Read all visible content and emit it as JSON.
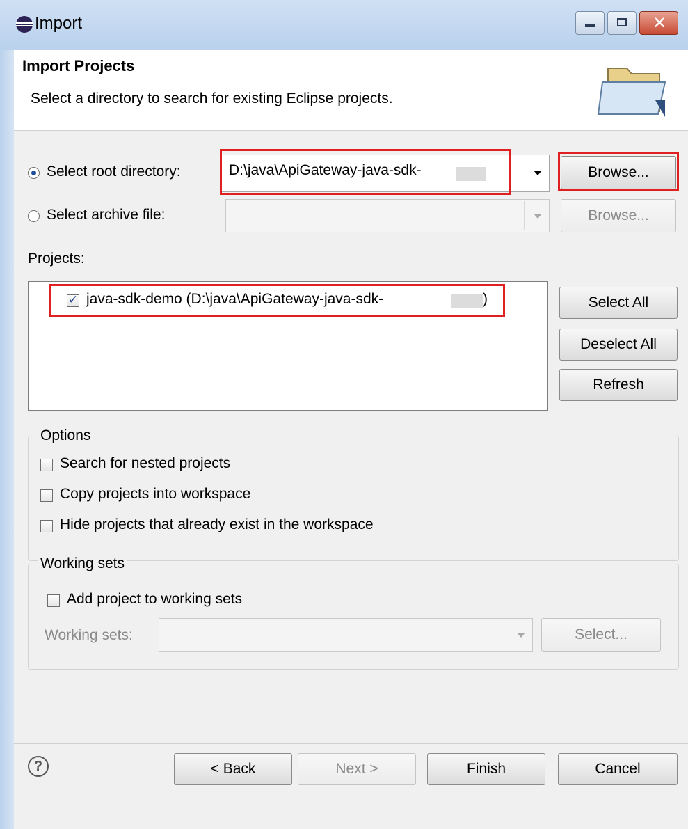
{
  "window": {
    "title": "Import"
  },
  "header": {
    "title": "Import Projects",
    "description": "Select a directory to search for existing Eclipse projects."
  },
  "source": {
    "root_directory_label": "Select root directory:",
    "root_directory_value": "D:\\java\\ApiGateway-java-sdk-",
    "root_selected": true,
    "archive_label": "Select archive file:",
    "archive_value": "",
    "archive_selected": false,
    "browse_label": "Browse...",
    "browse_disabled_label": "Browse..."
  },
  "projects": {
    "label": "Projects:",
    "items": [
      {
        "label": "java-sdk-demo (D:\\java\\ApiGateway-java-sdk-",
        "checked": true
      }
    ],
    "select_all": "Select All",
    "deselect_all": "Deselect All",
    "refresh": "Refresh"
  },
  "options": {
    "legend": "Options",
    "items": [
      {
        "label": "Search for nested projects",
        "checked": false
      },
      {
        "label": "Copy projects into workspace",
        "checked": false
      },
      {
        "label": "Hide projects that already exist in the workspace",
        "checked": false
      }
    ]
  },
  "working_sets": {
    "legend": "Working sets",
    "add_label": "Add project to working sets",
    "add_checked": false,
    "field_label": "Working sets:",
    "field_value": "",
    "select_button": "Select..."
  },
  "footer": {
    "help": "?",
    "back": "< Back",
    "next": "Next >",
    "finish": "Finish",
    "cancel": "Cancel"
  },
  "colors": {
    "highlight": "#e02020",
    "titlebar": "#c4d8ee"
  }
}
